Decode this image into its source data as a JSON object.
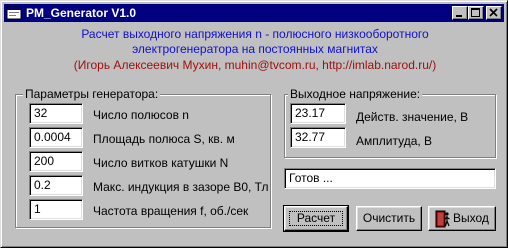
{
  "window": {
    "title": "PM_Generator V1.0"
  },
  "header": {
    "line1": "Расчет выходного напряжения n - полюсного низкооборотного",
    "line2": "электрогенератора на постоянных магнитах",
    "line3": "(Игорь Алексеевич Мухин, muhin@tvcom.ru, http://imlab.narod.ru/)"
  },
  "params_group": {
    "title": "Параметры генератора:",
    "fields": [
      {
        "value": "32",
        "label": "Число полюсов n"
      },
      {
        "value": "0.0004",
        "label": "Площадь полюса S, кв. м"
      },
      {
        "value": "200",
        "label": "Число витков катушки N"
      },
      {
        "value": "0.2",
        "label": "Макс. индукция в зазоре B0, Тл"
      },
      {
        "value": "1",
        "label": "Частота вращения f, об./сек"
      }
    ]
  },
  "output_group": {
    "title": "Выходное напряжение:",
    "fields": [
      {
        "value": "23.17",
        "label": "Действ. значение, В"
      },
      {
        "value": "32.77",
        "label": "Амплитуда, В"
      }
    ]
  },
  "status": {
    "text": "Готов ..."
  },
  "buttons": {
    "calc": "Расчет",
    "clear": "Очистить",
    "exit": "Выход"
  },
  "colors": {
    "titlebar": "#000080",
    "header_blue": "#1010d0",
    "header_red": "#a01010",
    "face": "#c0c0c0"
  }
}
